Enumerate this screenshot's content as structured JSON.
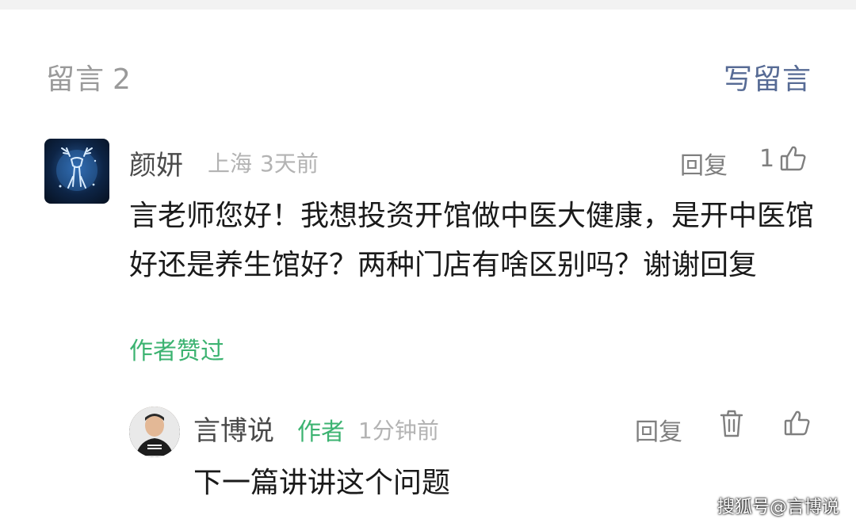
{
  "header": {
    "title": "留言",
    "count": "2",
    "write_label": "写留言"
  },
  "comments": [
    {
      "name": "颜妍",
      "location": "上海",
      "time": "3天前",
      "reply_label": "回复",
      "like_count": "1",
      "text": "言老师您好！我想投资开馆做中医大健康，是开中医馆好还是养生馆好？两种门店有啥区别吗？谢谢回复",
      "author_liked": "作者赞过",
      "avatar_icon": "deer-avatar"
    }
  ],
  "reply": {
    "name": "言博说",
    "badge": "作者",
    "time": "1分钟前",
    "reply_label": "回复",
    "text": "下一篇讲讲这个问题",
    "avatar_icon": "man-avatar"
  },
  "watermark": "搜狐号@言博说",
  "colors": {
    "link_blue": "#576b95",
    "green": "#3cb371",
    "gray_text": "#9a9a9a"
  }
}
